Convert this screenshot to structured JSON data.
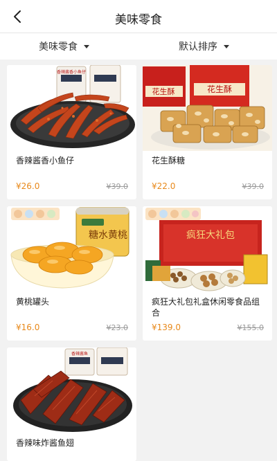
{
  "header": {
    "title": "美味零食",
    "back_icon": "chevron-left-icon"
  },
  "filters": {
    "category_label": "美味零食",
    "sort_label": "默认排序"
  },
  "products": [
    {
      "name": "香辣酱香小鱼仔",
      "price": "¥26.0",
      "old_price": "¥39.0",
      "image": "spicy-small-fish-image",
      "package_label": "香辣酱香小鱼仔"
    },
    {
      "name": "花生酥糖",
      "price": "¥22.0",
      "old_price": "¥39.0",
      "image": "peanut-brittle-image",
      "package_label": "花生酥"
    },
    {
      "name": "黄桃罐头",
      "price": "¥16.0",
      "old_price": "¥23.0",
      "image": "yellow-peach-can-image",
      "package_label": "糖水黄桃"
    },
    {
      "name": "疯狂大礼包礼盒休闲零食品组合",
      "price": "¥139.0",
      "old_price": "¥155.0",
      "image": "snack-gift-box-image",
      "package_label": "疯狂大礼包"
    },
    {
      "name": "香辣味炸酱鱼翅",
      "price": "",
      "old_price": "",
      "image": "spicy-fish-fin-image",
      "package_label": "香辣酱鱼"
    }
  ],
  "colors": {
    "price": "#e8891b",
    "background": "#f2f2f2"
  }
}
